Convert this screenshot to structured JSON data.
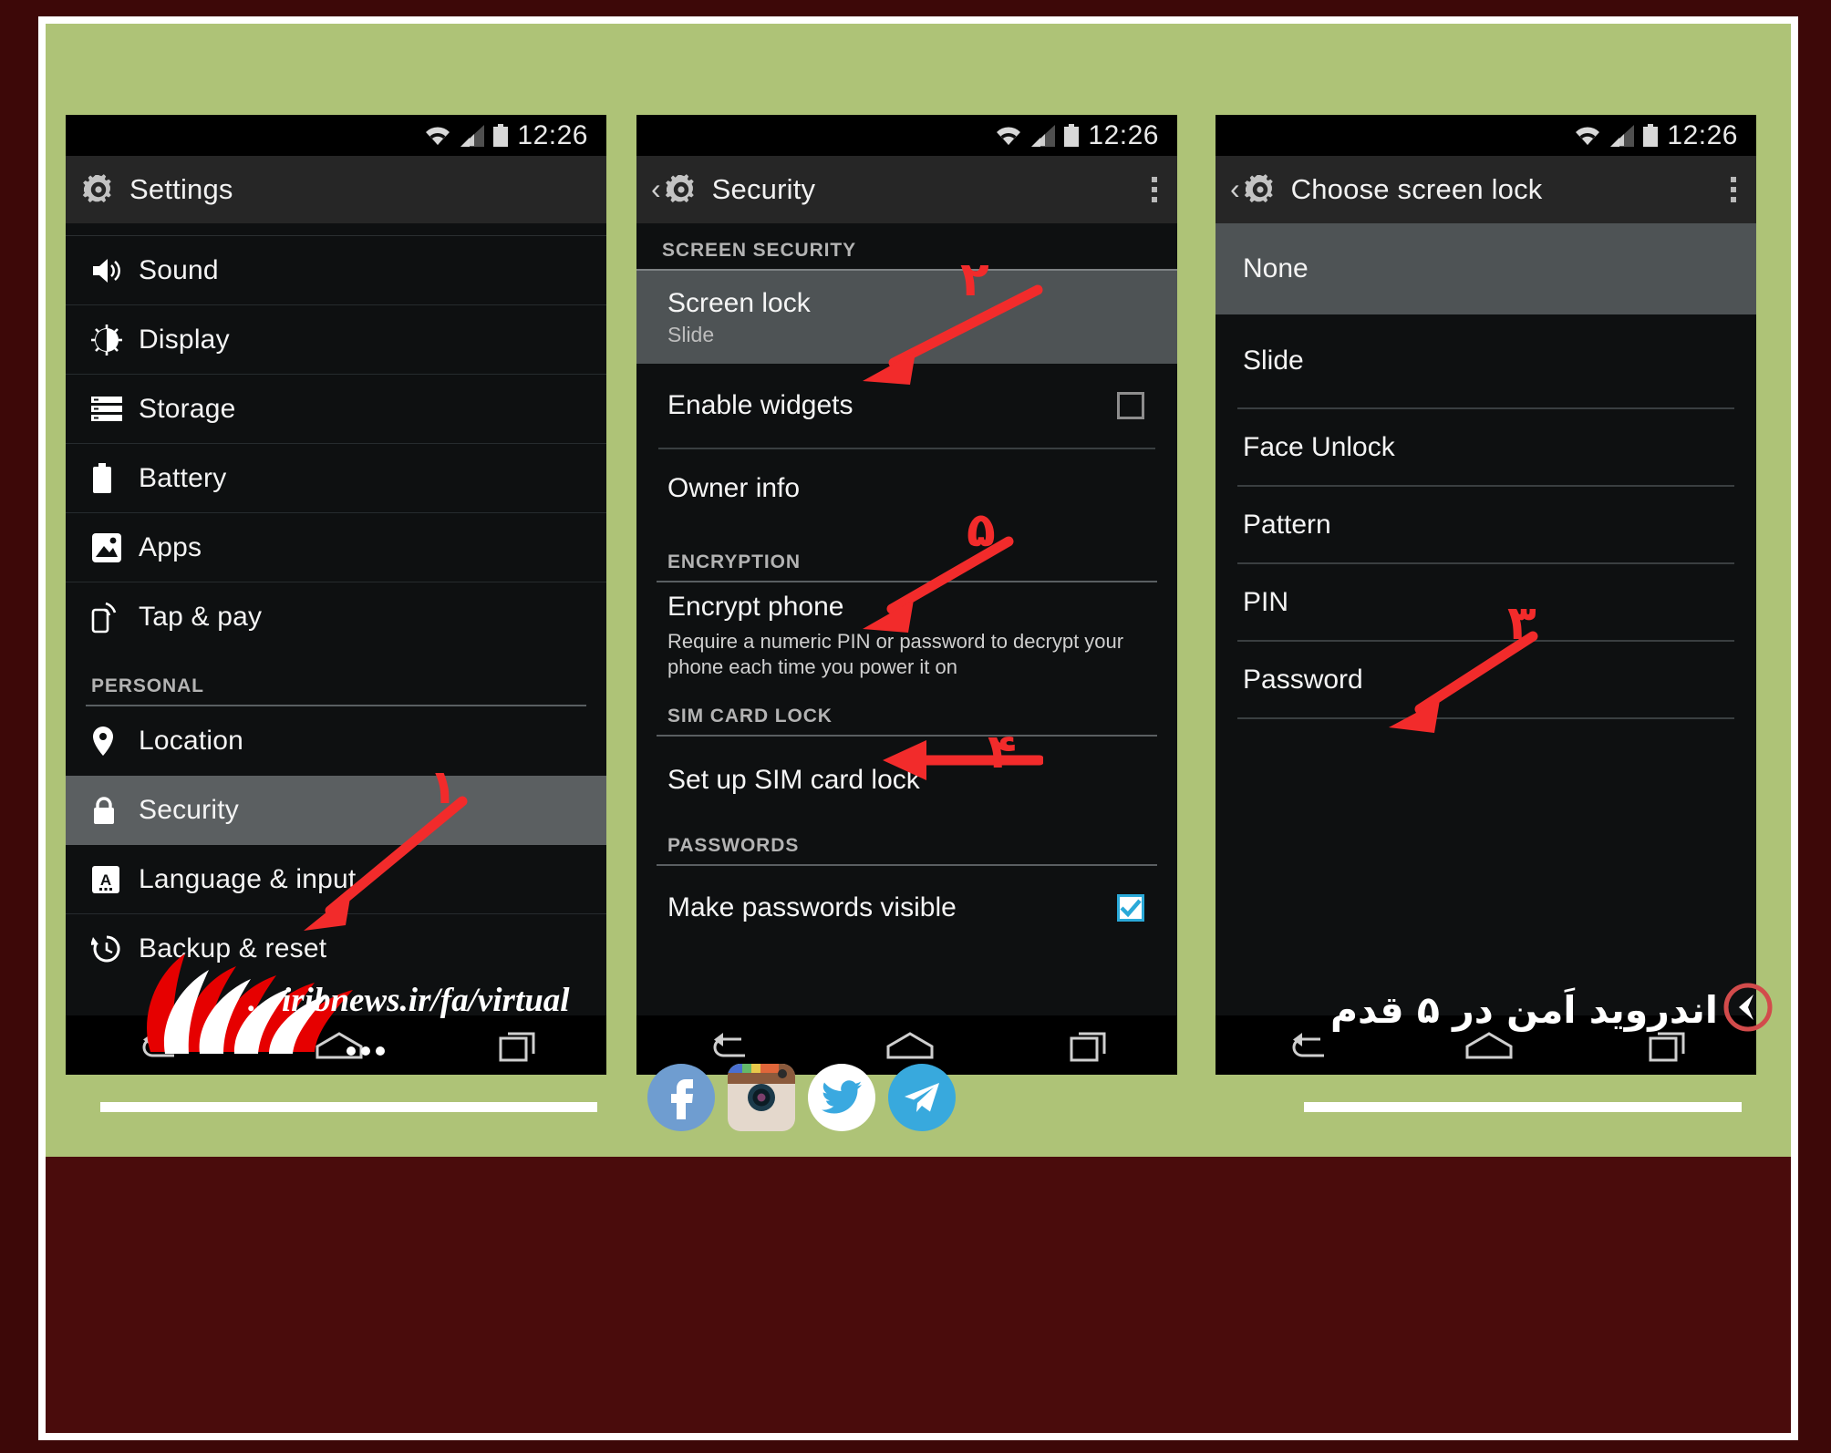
{
  "poster": {
    "bg_outer": "#3d0808",
    "bg_stage": "#aec377",
    "bg_footer": "#4a0c0c",
    "accent_red": "#f22b2b"
  },
  "statusbar": {
    "time": "12:26",
    "icons": [
      "wifi-icon",
      "signal-icon",
      "battery-icon"
    ]
  },
  "phone1": {
    "title": "Settings",
    "items": [
      {
        "label": "Sound",
        "icon": "speaker-icon"
      },
      {
        "label": "Display",
        "icon": "brightness-icon"
      },
      {
        "label": "Storage",
        "icon": "storage-icon"
      },
      {
        "label": "Battery",
        "icon": "battery-icon"
      },
      {
        "label": "Apps",
        "icon": "apps-icon"
      },
      {
        "label": "Tap & pay",
        "icon": "nfc-icon"
      }
    ],
    "section_header": "PERSONAL",
    "personal_items": [
      {
        "label": "Location",
        "icon": "location-pin-icon"
      },
      {
        "label": "Security",
        "icon": "lock-icon"
      },
      {
        "label": "Language & input",
        "icon": "keyboard-icon"
      },
      {
        "label": "Backup & reset",
        "icon": "backup-icon"
      }
    ],
    "selected": "Security",
    "step_number": "۱"
  },
  "phone2": {
    "title": "Security",
    "sections": [
      {
        "header": "SCREEN SECURITY"
      },
      {
        "header": "ENCRYPTION"
      },
      {
        "header": "SIM CARD LOCK"
      },
      {
        "header": "PASSWORDS"
      }
    ],
    "screen_lock": {
      "label": "Screen lock",
      "value": "Slide"
    },
    "enable_widgets": {
      "label": "Enable widgets",
      "checked": false
    },
    "owner_info": {
      "label": "Owner info"
    },
    "encrypt_phone": {
      "label": "Encrypt phone",
      "summary": "Require a numeric PIN or password to decrypt your phone each time you power it on"
    },
    "sim_lock": {
      "label": "Set up SIM card lock"
    },
    "passwords_visible": {
      "label": "Make passwords visible",
      "checked": true
    },
    "step_number_screenlock": "۲",
    "step_number_encrypt": "۵",
    "step_number_sim": "۴"
  },
  "phone3": {
    "title": "Choose screen lock",
    "options": [
      {
        "label": "None",
        "selected": true
      },
      {
        "label": "Slide",
        "selected": false
      },
      {
        "label": "Face Unlock",
        "selected": false
      },
      {
        "label": "Pattern",
        "selected": false
      },
      {
        "label": "PIN",
        "selected": false
      },
      {
        "label": "Password",
        "selected": false
      }
    ],
    "step_number": "۳"
  },
  "navbar": {
    "buttons": [
      "back-icon",
      "home-icon",
      "recents-icon"
    ]
  },
  "footer": {
    "url": "... iribnews.ir/fa/virtual",
    "headline": "اندروید اَمن در ۵ قدم",
    "logo_name": "irib-logo",
    "socials": [
      {
        "name": "facebook-icon",
        "color": "#6f9dd0"
      },
      {
        "name": "instagram-icon",
        "color": "#e4d8cc"
      },
      {
        "name": "twitter-icon",
        "color": "#ffffff"
      },
      {
        "name": "telegram-icon",
        "color": "#38a9dd"
      }
    ]
  }
}
